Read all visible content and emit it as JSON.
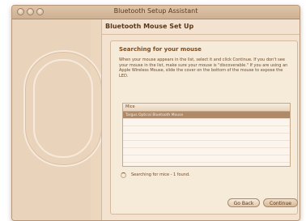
{
  "window": {
    "title": "Bluetooth Setup Assistant"
  },
  "content": {
    "heading": "Bluetooth Mouse Set Up",
    "panel": {
      "title": "Searching for your mouse",
      "instructions": "When your mouse appears in the list, select it and click Continue. If you don't see your mouse in the list, make sure your mouse is \"discoverable.\" If you are using an Apple Wireless Mouse, slide the cover on the bottom of the mouse to expose the LED."
    },
    "list": {
      "header": "Mice",
      "items": [
        {
          "label": "Targus Optical Bluetooth Mouse",
          "selected": true
        },
        {
          "label": ""
        },
        {
          "label": ""
        },
        {
          "label": ""
        },
        {
          "label": ""
        },
        {
          "label": ""
        },
        {
          "label": ""
        }
      ]
    },
    "status": "Searching for mice - 1 found."
  },
  "buttons": {
    "back": "Go Back",
    "continue": "Continue"
  }
}
